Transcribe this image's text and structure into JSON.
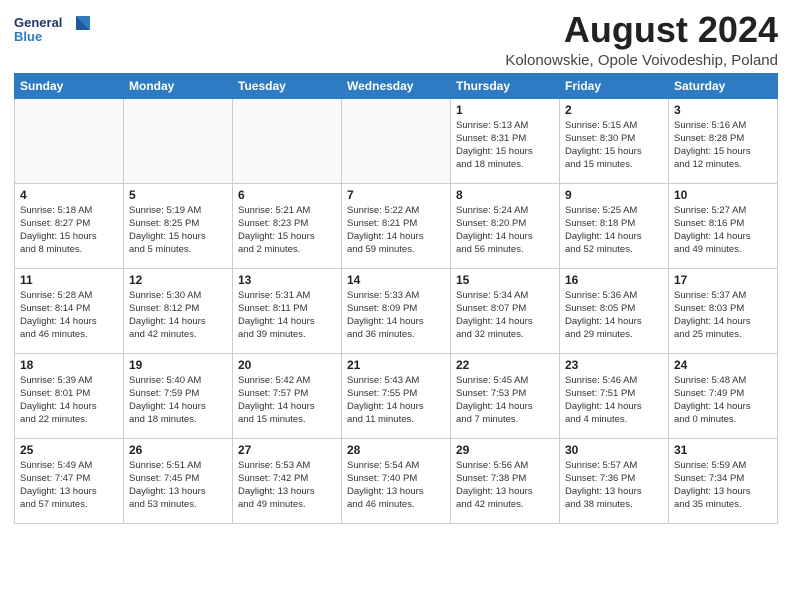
{
  "header": {
    "logo_general": "General",
    "logo_blue": "Blue",
    "month_title": "August 2024",
    "location": "Kolonowskie, Opole Voivodeship, Poland"
  },
  "days_of_week": [
    "Sunday",
    "Monday",
    "Tuesday",
    "Wednesday",
    "Thursday",
    "Friday",
    "Saturday"
  ],
  "weeks": [
    [
      {
        "num": "",
        "info": "",
        "empty": true
      },
      {
        "num": "",
        "info": "",
        "empty": true
      },
      {
        "num": "",
        "info": "",
        "empty": true
      },
      {
        "num": "",
        "info": "",
        "empty": true
      },
      {
        "num": "1",
        "info": "Sunrise: 5:13 AM\nSunset: 8:31 PM\nDaylight: 15 hours\nand 18 minutes.",
        "empty": false
      },
      {
        "num": "2",
        "info": "Sunrise: 5:15 AM\nSunset: 8:30 PM\nDaylight: 15 hours\nand 15 minutes.",
        "empty": false
      },
      {
        "num": "3",
        "info": "Sunrise: 5:16 AM\nSunset: 8:28 PM\nDaylight: 15 hours\nand 12 minutes.",
        "empty": false
      }
    ],
    [
      {
        "num": "4",
        "info": "Sunrise: 5:18 AM\nSunset: 8:27 PM\nDaylight: 15 hours\nand 8 minutes.",
        "empty": false
      },
      {
        "num": "5",
        "info": "Sunrise: 5:19 AM\nSunset: 8:25 PM\nDaylight: 15 hours\nand 5 minutes.",
        "empty": false
      },
      {
        "num": "6",
        "info": "Sunrise: 5:21 AM\nSunset: 8:23 PM\nDaylight: 15 hours\nand 2 minutes.",
        "empty": false
      },
      {
        "num": "7",
        "info": "Sunrise: 5:22 AM\nSunset: 8:21 PM\nDaylight: 14 hours\nand 59 minutes.",
        "empty": false
      },
      {
        "num": "8",
        "info": "Sunrise: 5:24 AM\nSunset: 8:20 PM\nDaylight: 14 hours\nand 56 minutes.",
        "empty": false
      },
      {
        "num": "9",
        "info": "Sunrise: 5:25 AM\nSunset: 8:18 PM\nDaylight: 14 hours\nand 52 minutes.",
        "empty": false
      },
      {
        "num": "10",
        "info": "Sunrise: 5:27 AM\nSunset: 8:16 PM\nDaylight: 14 hours\nand 49 minutes.",
        "empty": false
      }
    ],
    [
      {
        "num": "11",
        "info": "Sunrise: 5:28 AM\nSunset: 8:14 PM\nDaylight: 14 hours\nand 46 minutes.",
        "empty": false
      },
      {
        "num": "12",
        "info": "Sunrise: 5:30 AM\nSunset: 8:12 PM\nDaylight: 14 hours\nand 42 minutes.",
        "empty": false
      },
      {
        "num": "13",
        "info": "Sunrise: 5:31 AM\nSunset: 8:11 PM\nDaylight: 14 hours\nand 39 minutes.",
        "empty": false
      },
      {
        "num": "14",
        "info": "Sunrise: 5:33 AM\nSunset: 8:09 PM\nDaylight: 14 hours\nand 36 minutes.",
        "empty": false
      },
      {
        "num": "15",
        "info": "Sunrise: 5:34 AM\nSunset: 8:07 PM\nDaylight: 14 hours\nand 32 minutes.",
        "empty": false
      },
      {
        "num": "16",
        "info": "Sunrise: 5:36 AM\nSunset: 8:05 PM\nDaylight: 14 hours\nand 29 minutes.",
        "empty": false
      },
      {
        "num": "17",
        "info": "Sunrise: 5:37 AM\nSunset: 8:03 PM\nDaylight: 14 hours\nand 25 minutes.",
        "empty": false
      }
    ],
    [
      {
        "num": "18",
        "info": "Sunrise: 5:39 AM\nSunset: 8:01 PM\nDaylight: 14 hours\nand 22 minutes.",
        "empty": false
      },
      {
        "num": "19",
        "info": "Sunrise: 5:40 AM\nSunset: 7:59 PM\nDaylight: 14 hours\nand 18 minutes.",
        "empty": false
      },
      {
        "num": "20",
        "info": "Sunrise: 5:42 AM\nSunset: 7:57 PM\nDaylight: 14 hours\nand 15 minutes.",
        "empty": false
      },
      {
        "num": "21",
        "info": "Sunrise: 5:43 AM\nSunset: 7:55 PM\nDaylight: 14 hours\nand 11 minutes.",
        "empty": false
      },
      {
        "num": "22",
        "info": "Sunrise: 5:45 AM\nSunset: 7:53 PM\nDaylight: 14 hours\nand 7 minutes.",
        "empty": false
      },
      {
        "num": "23",
        "info": "Sunrise: 5:46 AM\nSunset: 7:51 PM\nDaylight: 14 hours\nand 4 minutes.",
        "empty": false
      },
      {
        "num": "24",
        "info": "Sunrise: 5:48 AM\nSunset: 7:49 PM\nDaylight: 14 hours\nand 0 minutes.",
        "empty": false
      }
    ],
    [
      {
        "num": "25",
        "info": "Sunrise: 5:49 AM\nSunset: 7:47 PM\nDaylight: 13 hours\nand 57 minutes.",
        "empty": false
      },
      {
        "num": "26",
        "info": "Sunrise: 5:51 AM\nSunset: 7:45 PM\nDaylight: 13 hours\nand 53 minutes.",
        "empty": false
      },
      {
        "num": "27",
        "info": "Sunrise: 5:53 AM\nSunset: 7:42 PM\nDaylight: 13 hours\nand 49 minutes.",
        "empty": false
      },
      {
        "num": "28",
        "info": "Sunrise: 5:54 AM\nSunset: 7:40 PM\nDaylight: 13 hours\nand 46 minutes.",
        "empty": false
      },
      {
        "num": "29",
        "info": "Sunrise: 5:56 AM\nSunset: 7:38 PM\nDaylight: 13 hours\nand 42 minutes.",
        "empty": false
      },
      {
        "num": "30",
        "info": "Sunrise: 5:57 AM\nSunset: 7:36 PM\nDaylight: 13 hours\nand 38 minutes.",
        "empty": false
      },
      {
        "num": "31",
        "info": "Sunrise: 5:59 AM\nSunset: 7:34 PM\nDaylight: 13 hours\nand 35 minutes.",
        "empty": false
      }
    ]
  ]
}
